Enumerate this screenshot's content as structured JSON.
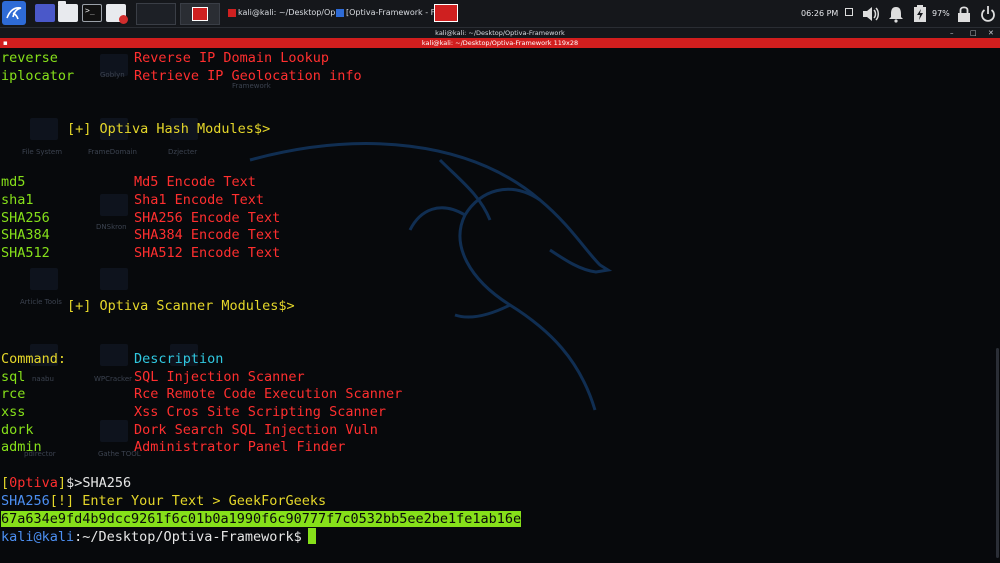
{
  "panel": {
    "clock": "06:26 PM",
    "battery": "97%",
    "taskbar": [
      {
        "label": "kali@kali: ~/Desktop/Op..."
      },
      {
        "label": "[Optiva-Framework - Fil..."
      }
    ]
  },
  "window": {
    "title": "kali@kali: ~/Desktop/Optiva-Framework",
    "tab_title": "kali@kali: ~/Desktop/Optiva-Framework 119x28"
  },
  "desktop_icons": [
    "Goblyn",
    "Framework",
    "File System",
    "FrameDomain",
    "Dzjecter",
    "DNSkron",
    "Article Tools",
    "naabu",
    "WPCracker",
    "Gathe TOOL",
    "pdirector"
  ],
  "terminal": {
    "lines": [
      {
        "cmd": "reverse",
        "desc": "Reverse IP Domain Lookup"
      },
      {
        "cmd": "iplocator",
        "desc": "Retrieve IP Geolocation info"
      },
      {
        "section": "[+] Optiva Hash Modules$>"
      },
      {
        "cmd": "md5",
        "desc": "Md5 Encode Text"
      },
      {
        "cmd": "sha1",
        "desc": "Sha1 Encode Text"
      },
      {
        "cmd": "SHA256",
        "desc": "SHA256 Encode Text"
      },
      {
        "cmd": "SHA384",
        "desc": "SHA384 Encode Text"
      },
      {
        "cmd": "SHA512",
        "desc": "SHA512 Encode Text"
      },
      {
        "section": "[+] Optiva Scanner Modules$>"
      },
      {
        "cmd": "Command:",
        "desc": "Description"
      },
      {
        "cmd": "sql",
        "desc": "SQL Injection Scanner"
      },
      {
        "cmd": "rce",
        "desc": "Rce Remote Code Execution Scanner"
      },
      {
        "cmd": "xss",
        "desc": "Xss Cros Site Scripting Scanner"
      },
      {
        "cmd": "dork",
        "desc": "Dork Search SQL Injection Vuln"
      },
      {
        "cmd": "admin",
        "desc": "Administrator Panel Finder"
      }
    ],
    "prompt_user_open": "[",
    "prompt_user": "0ptiva",
    "prompt_user_close": "]",
    "prompt_cmd": "$>SHA256",
    "sha_label": "SHA256",
    "sha_prompt": "[!] Enter Your Text > GeekForGeeks",
    "hash": "67a634e9fd4b9dcc9261f6c01b0a1990f6c90777f7c0532bb5ee2be1fe1ab16e",
    "shell_user": "kali@kali",
    "shell_path": ":~/Desktop/Optiva-Framework",
    "shell_dollar": "$"
  }
}
